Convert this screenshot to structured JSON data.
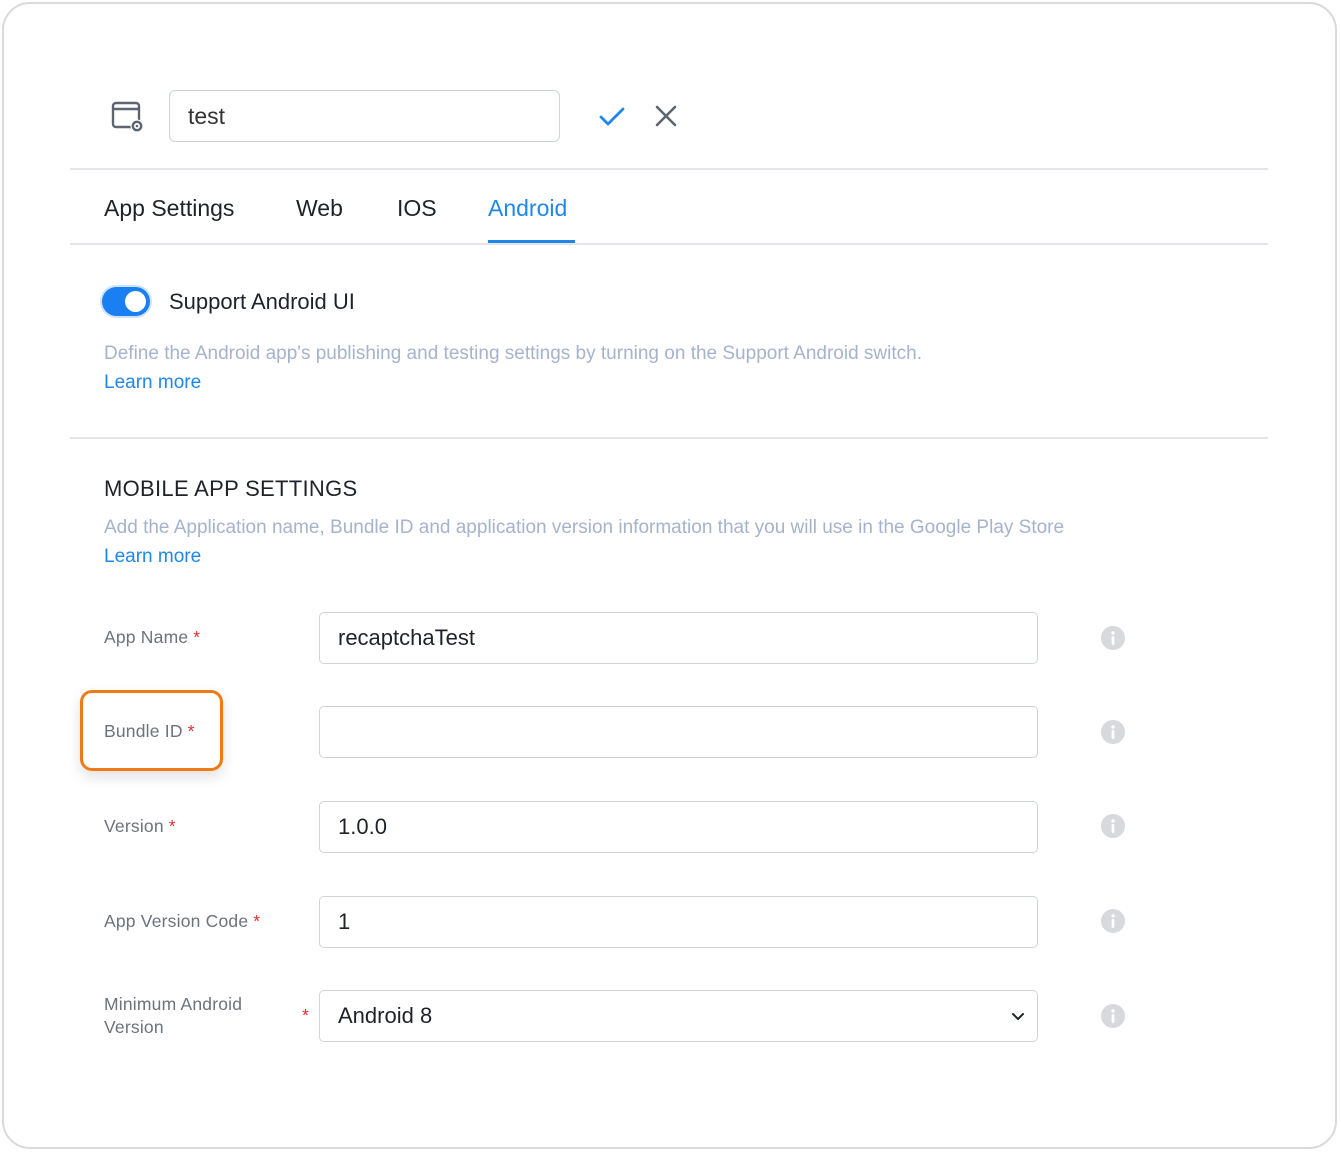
{
  "header": {
    "name_value": "test",
    "app_icon": "browser-settings-icon",
    "confirm_icon": "checkmark-icon",
    "cancel_icon": "close-icon"
  },
  "tabs": [
    {
      "label": "App Settings",
      "active": false
    },
    {
      "label": "Web",
      "active": false
    },
    {
      "label": "IOS",
      "active": false
    },
    {
      "label": "Android",
      "active": true
    }
  ],
  "support": {
    "toggle_on": true,
    "label": "Support Android UI",
    "description": "Define the Android app's publishing and testing settings by turning on the Support Android switch.",
    "learn_more": "Learn more"
  },
  "mobile_settings": {
    "title": "MOBILE APP SETTINGS",
    "description": "Add the Application name, Bundle ID and application version information that you will use in the Google Play Store",
    "learn_more": "Learn more"
  },
  "form": {
    "required_marker": "*",
    "fields": [
      {
        "label": "App Name",
        "value": "recaptchaTest",
        "type": "text"
      },
      {
        "label": "Bundle ID",
        "value": "",
        "type": "text",
        "highlighted": true
      },
      {
        "label": "Version",
        "value": "1.0.0",
        "type": "text"
      },
      {
        "label": "App Version Code",
        "value": "1",
        "type": "text"
      },
      {
        "label_line1": "Minimum Android",
        "label_line2": "Version",
        "value": "Android 8",
        "type": "select"
      }
    ]
  },
  "colors": {
    "accent": "#1f87ea",
    "toggle": "#1a7ff0",
    "required": "#e0302a",
    "highlight": "#f07b16",
    "description_text": "#a6b3cc"
  }
}
